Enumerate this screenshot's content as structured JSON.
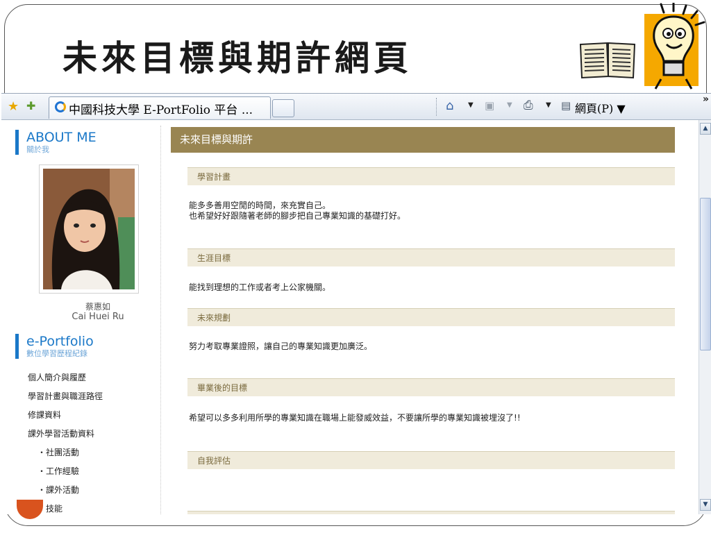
{
  "slide": {
    "title": "未來目標與期許網頁"
  },
  "browser": {
    "tab_title": "中國科技大學 E-PortFolio 平台 ...",
    "page_menu_label": "網頁(P)",
    "more_label": "»"
  },
  "sidebar": {
    "about_title": "ABOUT ME",
    "about_sub": "關於我",
    "name_cn": "蔡惠如",
    "name_en": "Cai Huei Ru",
    "portfolio_title": "e-Portfolio",
    "portfolio_sub": "數位學習歷程紀錄",
    "menu": [
      {
        "label": "個人簡介與履歷",
        "sub": false
      },
      {
        "label": "學習計畫與職涯路徑",
        "sub": false
      },
      {
        "label": "修課資料",
        "sub": false
      },
      {
        "label": "課外學習活動資料",
        "sub": false
      },
      {
        "label": "・社團活動",
        "sub": true
      },
      {
        "label": "・工作經驗",
        "sub": true
      },
      {
        "label": "・課外活動",
        "sub": true
      },
      {
        "label": "・技能",
        "sub": true
      }
    ]
  },
  "main": {
    "header": "未來目標與期許",
    "sections": [
      {
        "title": "學習計畫",
        "lines": [
          "能多多善用空閒的時間，來充實自己。",
          "也希望好好跟隨著老師的腳步把自己專業知識的基礎打好。"
        ]
      },
      {
        "title": "生涯目標",
        "lines": [
          "能找到理想的工作或者考上公家機關。"
        ]
      },
      {
        "title": "未來規劃",
        "lines": [
          "努力考取專業證照，讓自己的專業知識更加廣泛。"
        ]
      },
      {
        "title": "畢業後的目標",
        "lines": [
          "希望可以多多利用所學的專業知識在職場上能發威效益，不要讓所學的專業知識被埋沒了!!"
        ]
      },
      {
        "title": "自我評估",
        "lines": []
      }
    ]
  },
  "colors": {
    "accent_blue": "#1a78c8",
    "header_brown": "#998552",
    "section_bg": "#f0ebdb"
  },
  "icons": [
    "book-icon",
    "lightbulb-icon",
    "favorites-star-icon",
    "add-favorite-icon",
    "ie-page-icon",
    "home-icon",
    "rss-feed-icon",
    "print-icon",
    "page-icon",
    "scroll-up-icon",
    "scroll-down-icon"
  ]
}
